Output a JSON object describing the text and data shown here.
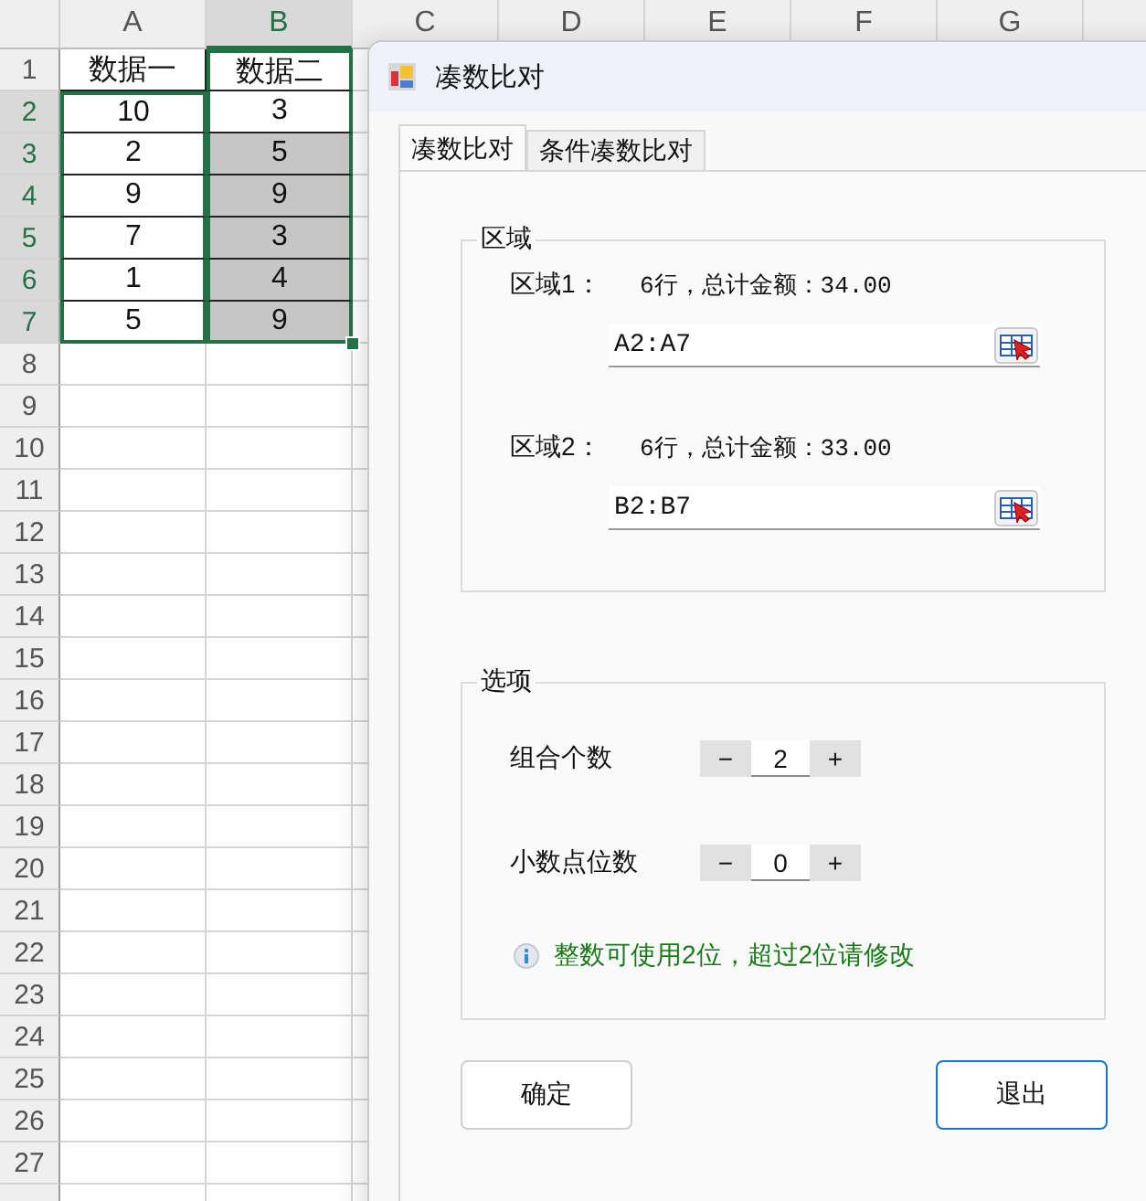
{
  "sheet": {
    "columns": [
      {
        "label": "A",
        "selected": false
      },
      {
        "label": "B",
        "selected": true
      },
      {
        "label": "C",
        "selected": false
      },
      {
        "label": "D",
        "selected": false
      },
      {
        "label": "E",
        "selected": false
      },
      {
        "label": "F",
        "selected": false
      },
      {
        "label": "G",
        "selected": false
      }
    ],
    "rows": [
      {
        "label": "1",
        "selected": false,
        "cells": [
          {
            "text": "数据一",
            "selected": false,
            "in_range": false
          },
          {
            "text": "数据二",
            "selected": false,
            "in_range": true
          }
        ]
      },
      {
        "label": "2",
        "selected": true,
        "cells": [
          {
            "text": "10",
            "selected": false,
            "in_range": true
          },
          {
            "text": "3",
            "selected": false,
            "in_range": true
          }
        ]
      },
      {
        "label": "3",
        "selected": true,
        "cells": [
          {
            "text": "2",
            "selected": false,
            "in_range": true
          },
          {
            "text": "5",
            "selected": true,
            "in_range": true
          }
        ]
      },
      {
        "label": "4",
        "selected": true,
        "cells": [
          {
            "text": "9",
            "selected": false,
            "in_range": true
          },
          {
            "text": "9",
            "selected": true,
            "in_range": true
          }
        ]
      },
      {
        "label": "5",
        "selected": true,
        "cells": [
          {
            "text": "7",
            "selected": false,
            "in_range": true
          },
          {
            "text": "3",
            "selected": true,
            "in_range": true
          }
        ]
      },
      {
        "label": "6",
        "selected": true,
        "cells": [
          {
            "text": "1",
            "selected": false,
            "in_range": true
          },
          {
            "text": "4",
            "selected": true,
            "in_range": true
          }
        ]
      },
      {
        "label": "7",
        "selected": true,
        "cells": [
          {
            "text": "5",
            "selected": false,
            "in_range": true
          },
          {
            "text": "9",
            "selected": true,
            "in_range": true
          }
        ]
      },
      {
        "label": "8",
        "selected": false
      },
      {
        "label": "9",
        "selected": false
      },
      {
        "label": "10",
        "selected": false
      },
      {
        "label": "11",
        "selected": false
      },
      {
        "label": "12",
        "selected": false
      },
      {
        "label": "13",
        "selected": false
      },
      {
        "label": "14",
        "selected": false
      },
      {
        "label": "15",
        "selected": false
      },
      {
        "label": "16",
        "selected": false
      },
      {
        "label": "17",
        "selected": false
      },
      {
        "label": "18",
        "selected": false
      },
      {
        "label": "19",
        "selected": false
      },
      {
        "label": "20",
        "selected": false
      },
      {
        "label": "21",
        "selected": false
      },
      {
        "label": "22",
        "selected": false
      },
      {
        "label": "23",
        "selected": false
      },
      {
        "label": "24",
        "selected": false
      },
      {
        "label": "25",
        "selected": false
      },
      {
        "label": "26",
        "selected": false
      },
      {
        "label": "27",
        "selected": false
      }
    ]
  },
  "dialog": {
    "title": "凑数比对",
    "tabs": [
      {
        "label": "凑数比对",
        "selected": true
      },
      {
        "label": "条件凑数比对",
        "selected": false
      }
    ],
    "region_group": {
      "title": "区域",
      "regions": [
        {
          "label": "区域1：",
          "summary": "6行，总计金额：34.00",
          "value": "A2:A7"
        },
        {
          "label": "区域2：",
          "summary": "6行，总计金额：33.00",
          "value": "B2:B7"
        }
      ]
    },
    "options_group": {
      "title": "选项",
      "spinners": [
        {
          "label": "组合个数",
          "decrement": "−",
          "value": "2",
          "increment": "+"
        },
        {
          "label": "小数点位数",
          "decrement": "−",
          "value": "0",
          "increment": "+"
        }
      ],
      "note": "整数可使用2位，超过2位请修改"
    },
    "buttons": [
      {
        "label": "确定",
        "default": false
      },
      {
        "label": "退出",
        "default": true
      }
    ]
  }
}
